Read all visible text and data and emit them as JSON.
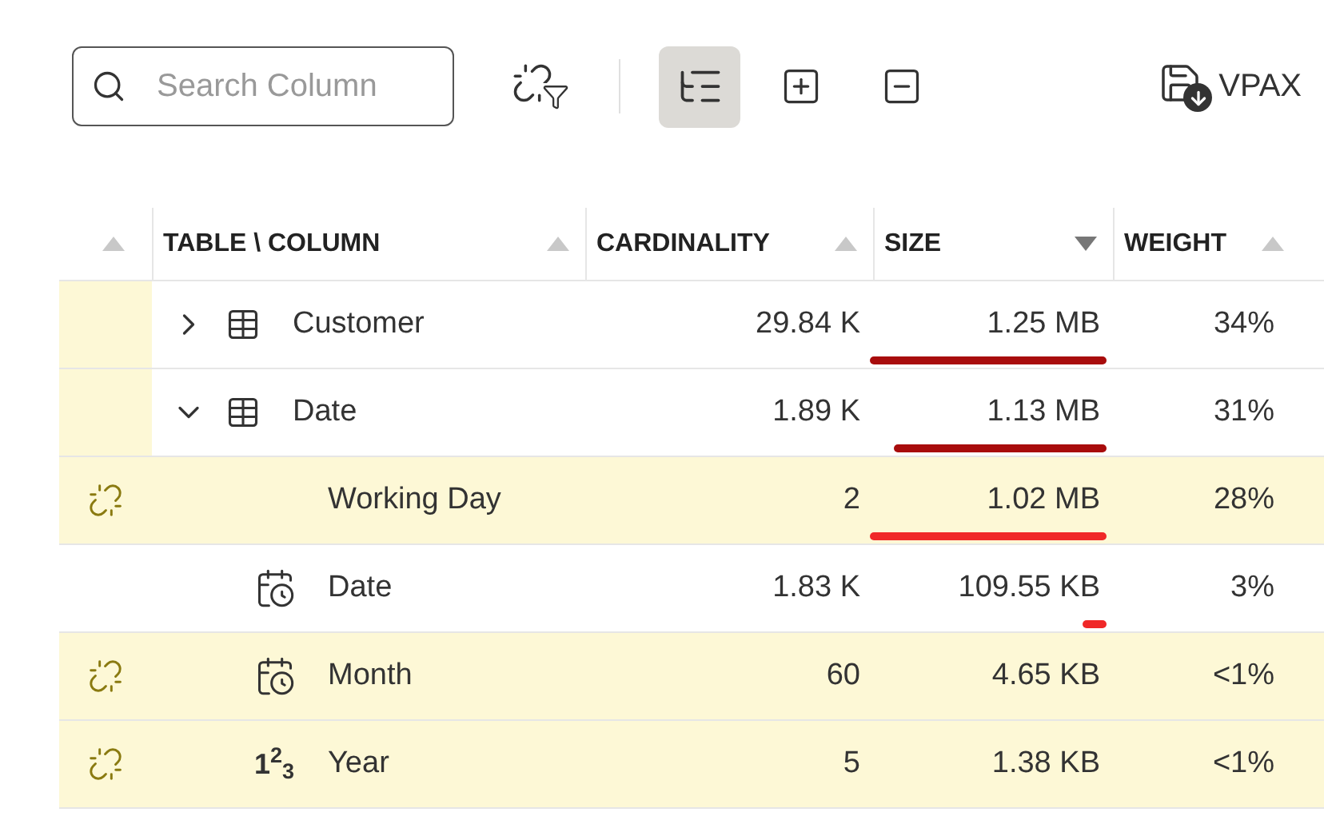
{
  "toolbar": {
    "search": {
      "placeholder": "Search Column"
    },
    "buttons": [
      {
        "kind": "unused-filter",
        "selected": false
      },
      {
        "kind": "tree-view",
        "selected": true
      },
      {
        "kind": "expand-all",
        "selected": false
      },
      {
        "kind": "collapse-all",
        "selected": false
      }
    ],
    "export": {
      "label": "VPAX"
    }
  },
  "table": {
    "columns": [
      {
        "descending": false,
        "active": false
      },
      {
        "label": "TABLE \\ COLUMN",
        "descending": false,
        "active": false
      },
      {
        "label": "CARDINALITY",
        "descending": false,
        "active": false
      },
      {
        "label": "SIZE",
        "descending": true,
        "active": true
      },
      {
        "label": "WEIGHT",
        "descending": false,
        "active": false
      }
    ],
    "rows": [
      {
        "kind": "table",
        "name": "Customer",
        "expanded": false,
        "marked": true,
        "cardinality": "29.84 K",
        "size": "1.25 MB",
        "level": 1.0,
        "weight": "34%"
      },
      {
        "kind": "table",
        "name": "Date",
        "expanded": true,
        "marked": true,
        "cardinality": "1.89 K",
        "size": "1.13 MB",
        "level": 0.9,
        "weight": "31%",
        "children": [
          {
            "kind": "plain-column",
            "name": "Working Day",
            "unused": true,
            "cardinality": "2",
            "size": "1.02 MB",
            "level": 1.0,
            "weight": "28%"
          },
          {
            "kind": "date-column",
            "name": "Date",
            "unused": false,
            "cardinality": "1.83 K",
            "size": "109.55 KB",
            "level": 0.1,
            "weight": "3%"
          },
          {
            "kind": "date-column",
            "name": "Month",
            "unused": true,
            "cardinality": "60",
            "size": "4.65 KB",
            "weight": "<1%"
          },
          {
            "kind": "number-column",
            "name": "Year",
            "data_symbol": "1$^{2}$$_{3}$",
            "unused": true,
            "cardinality": "5",
            "size": "1.38 KB",
            "weight": "<1%"
          }
        ]
      }
    ]
  }
}
